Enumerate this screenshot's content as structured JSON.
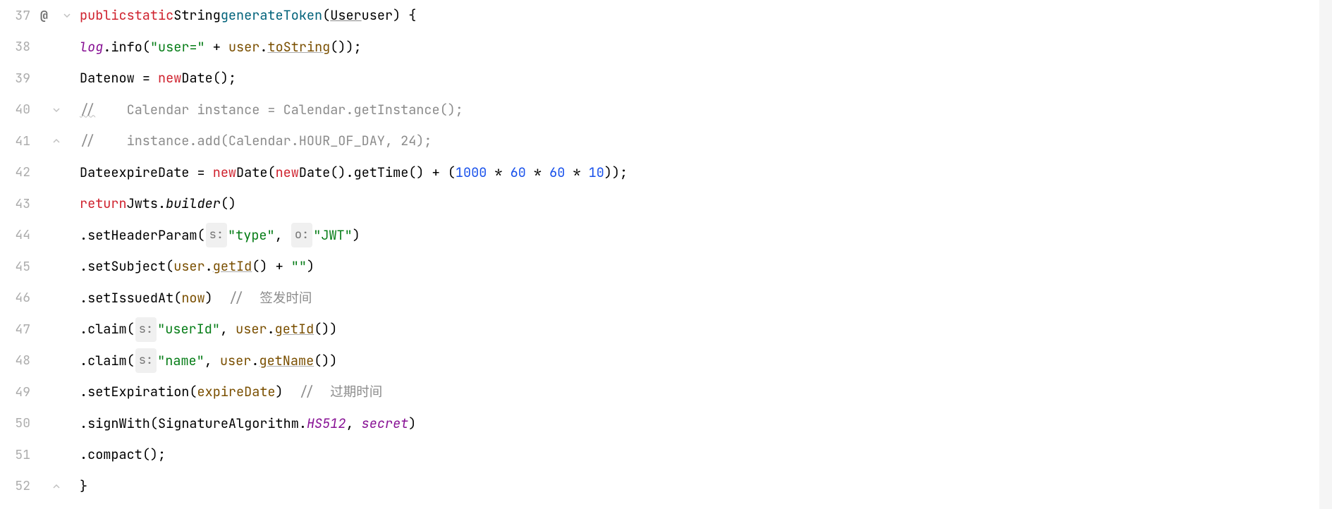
{
  "lines": [
    {
      "num": "37",
      "at": "@",
      "fold": "down"
    },
    {
      "num": "38"
    },
    {
      "num": "39"
    },
    {
      "num": "40",
      "fold": "down"
    },
    {
      "num": "41",
      "fold": "up"
    },
    {
      "num": "42"
    },
    {
      "num": "43"
    },
    {
      "num": "44"
    },
    {
      "num": "45"
    },
    {
      "num": "46"
    },
    {
      "num": "47"
    },
    {
      "num": "48"
    },
    {
      "num": "49"
    },
    {
      "num": "50"
    },
    {
      "num": "51"
    },
    {
      "num": "52",
      "fold": "up"
    }
  ],
  "code": {
    "l37": {
      "kw_public": "public",
      "kw_static": "static",
      "type_string": "String",
      "method": "generateToken",
      "param_type": "User",
      "param_name": "user",
      "brace_open": " {"
    },
    "l38": {
      "field_log": "log",
      "method_info": "info",
      "string1": "\"user=\"",
      "plus": " + ",
      "param_user": "user",
      "method_tostring": "toString",
      "tail": "());"
    },
    "l39": {
      "type_date": "Date",
      "var_now": "now",
      "eq": " = ",
      "kw_new": "new",
      "type_date2": "Date",
      "tail": "();"
    },
    "l40": {
      "comment": "//",
      "comment_text": "    Calendar instance = Calendar.getInstance();"
    },
    "l41": {
      "comment": "//",
      "comment_text": "    instance.add(Calendar.HOUR_OF_DAY, 24);"
    },
    "l42": {
      "type_date": "Date",
      "var_exp": "expireDate",
      "eq": " = ",
      "kw_new1": "new",
      "type_date2": "Date",
      "kw_new2": "new",
      "type_date3": "Date",
      "method_gettime": "getTime",
      "plus": " + (",
      "n1000": "1000",
      "star": " * ",
      "n60a": "60",
      "n60b": "60",
      "n10": "10",
      "tail": "));"
    },
    "l43": {
      "kw_return": "return",
      "class_jwts": "Jwts",
      "method_builder": "builder",
      "tail": "()"
    },
    "l44": {
      "method": "setHeaderParam",
      "hint_s": "s:",
      "str_type": "\"type\"",
      "comma": ", ",
      "hint_o": "o:",
      "str_jwt": "\"JWT\"",
      "tail": ")"
    },
    "l45": {
      "method": "setSubject",
      "param_user": "user",
      "method_getid": "getId",
      "mid": "() + ",
      "str_empty": "\"\"",
      "tail": ")"
    },
    "l46": {
      "method": "setIssuedAt",
      "var_now": "now",
      "close": ")  ",
      "comment": "//",
      "comment_text": "  签发时间"
    },
    "l47": {
      "method": "claim",
      "hint_s": "s:",
      "str_userid": "\"userId\"",
      "comma": ", ",
      "param_user": "user",
      "method_getid": "getId",
      "tail": "())"
    },
    "l48": {
      "method": "claim",
      "hint_s": "s:",
      "str_name": "\"name\"",
      "comma": ", ",
      "param_user": "user",
      "method_getname": "getName",
      "tail": "())"
    },
    "l49": {
      "method": "setExpiration",
      "var_exp": "expireDate",
      "close": ")  ",
      "comment": "//",
      "comment_text": "  过期时间"
    },
    "l50": {
      "method": "signWith",
      "class_sig": "SignatureAlgorithm",
      "field_hs512": "HS512",
      "comma": ", ",
      "field_secret": "secret",
      "tail": ")"
    },
    "l51": {
      "method": "compact",
      "tail": "();"
    },
    "l52": {
      "brace": "}"
    }
  }
}
